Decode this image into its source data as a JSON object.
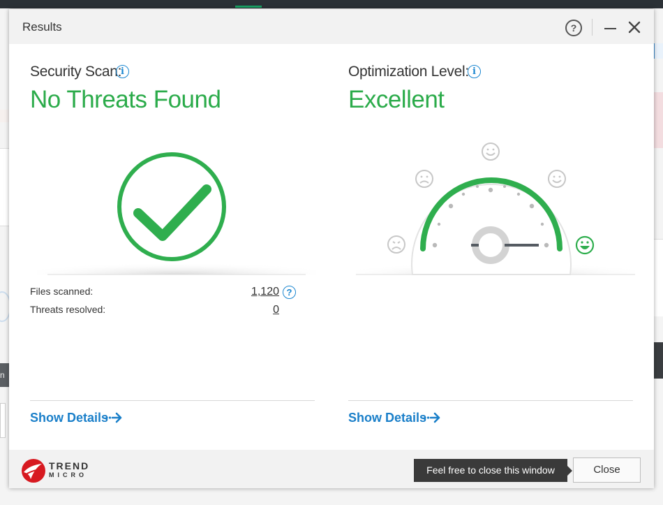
{
  "window": {
    "title": "Results",
    "help_glyph": "?"
  },
  "security": {
    "heading": "Security Scan:",
    "status": "No Threats Found",
    "status_color": "#2bab4a",
    "stats": [
      {
        "label": "Files scanned:",
        "value": "1,120"
      },
      {
        "label": "Threats resolved:",
        "value": "0"
      }
    ],
    "details_label": "Show Details"
  },
  "optimization": {
    "heading": "Optimization Level:",
    "status": "Excellent",
    "gauge_level": 1.0,
    "details_label": "Show Details"
  },
  "info_glyph": "i",
  "footer": {
    "brand_top": "TREND",
    "brand_bottom": "MICRO",
    "brand_color": "#d71920",
    "tooltip": "Feel free to close this window",
    "close_label": "Close"
  },
  "background": {
    "left_bar_text": "n"
  },
  "icons": [
    "help-icon",
    "minimize-icon",
    "close-icon",
    "info-icon",
    "checkmark-icon",
    "gauge-icon",
    "smiley-icons",
    "dotted-arrow-icon",
    "trend-micro-logo"
  ]
}
